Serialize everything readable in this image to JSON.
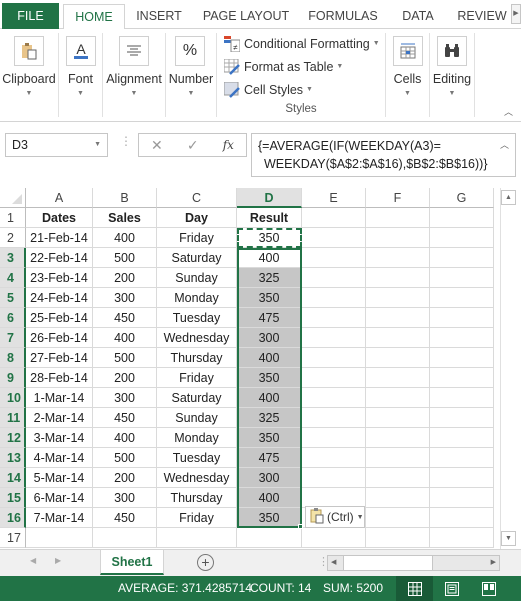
{
  "ribbon_tabs": [
    {
      "label": "FILE"
    },
    {
      "label": "HOME"
    },
    {
      "label": "INSERT"
    },
    {
      "label": "PAGE LAYOUT"
    },
    {
      "label": "FORMULAS"
    },
    {
      "label": "DATA"
    },
    {
      "label": "REVIEW"
    }
  ],
  "ribbon_groups": {
    "clipboard": "Clipboard",
    "font": "Font",
    "alignment": "Alignment",
    "number": "Number",
    "number_icon_glyph": "%",
    "styles": {
      "items": [
        "Conditional Formatting",
        "Format as Table",
        "Cell Styles"
      ],
      "label": "Styles"
    },
    "cells": "Cells",
    "editing": "Editing"
  },
  "formula_bar": {
    "name_box": "D3",
    "fx_label": "fx",
    "formula_line1": "{=AVERAGE(IF(WEEKDAY(A3)=",
    "formula_line2": "WEEKDAY($A$2:$A$16),$B$2:$B$16))}"
  },
  "columns": [
    "A",
    "B",
    "C",
    "D",
    "E",
    "F",
    "G"
  ],
  "selected_column": "D",
  "rows": [
    {
      "n": "1",
      "cells": [
        "Dates",
        "Sales",
        "Day",
        "Result"
      ]
    },
    {
      "n": "2",
      "cells": [
        "21-Feb-14",
        "400",
        "Friday",
        "350"
      ]
    },
    {
      "n": "3",
      "cells": [
        "22-Feb-14",
        "500",
        "Saturday",
        "400"
      ]
    },
    {
      "n": "4",
      "cells": [
        "23-Feb-14",
        "200",
        "Sunday",
        "325"
      ]
    },
    {
      "n": "5",
      "cells": [
        "24-Feb-14",
        "300",
        "Monday",
        "350"
      ]
    },
    {
      "n": "6",
      "cells": [
        "25-Feb-14",
        "450",
        "Tuesday",
        "475"
      ]
    },
    {
      "n": "7",
      "cells": [
        "26-Feb-14",
        "400",
        "Wednesday",
        "300"
      ]
    },
    {
      "n": "8",
      "cells": [
        "27-Feb-14",
        "500",
        "Thursday",
        "400"
      ]
    },
    {
      "n": "9",
      "cells": [
        "28-Feb-14",
        "200",
        "Friday",
        "350"
      ]
    },
    {
      "n": "10",
      "cells": [
        "1-Mar-14",
        "300",
        "Saturday",
        "400"
      ]
    },
    {
      "n": "11",
      "cells": [
        "2-Mar-14",
        "450",
        "Sunday",
        "325"
      ]
    },
    {
      "n": "12",
      "cells": [
        "3-Mar-14",
        "400",
        "Monday",
        "350"
      ]
    },
    {
      "n": "13",
      "cells": [
        "4-Mar-14",
        "500",
        "Tuesday",
        "475"
      ]
    },
    {
      "n": "14",
      "cells": [
        "5-Mar-14",
        "200",
        "Wednesday",
        "300"
      ]
    },
    {
      "n": "15",
      "cells": [
        "6-Mar-14",
        "300",
        "Thursday",
        "400"
      ]
    },
    {
      "n": "16",
      "cells": [
        "7-Mar-14",
        "450",
        "Friday",
        "350"
      ]
    },
    {
      "n": "17",
      "cells": [
        "",
        "",
        "",
        ""
      ]
    }
  ],
  "paste_options": {
    "label": "(Ctrl)"
  },
  "sheet_tabs": [
    {
      "label": "Sheet1",
      "active": true
    }
  ],
  "status_bar": {
    "average": "AVERAGE: 371.4285714",
    "count": "COUNT: 14",
    "sum": "SUM: 5200"
  },
  "colors": {
    "accent": "#217346",
    "selection_fill": "#c6c6c6"
  }
}
